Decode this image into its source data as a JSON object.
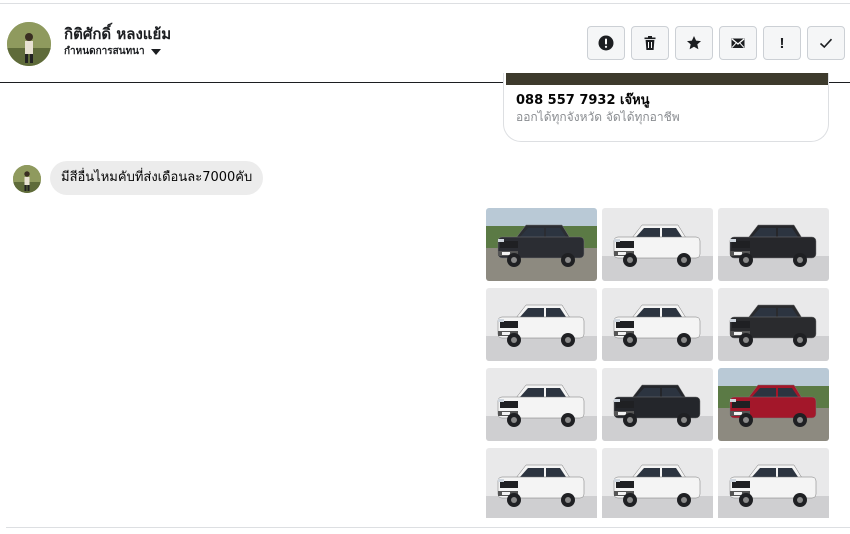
{
  "header": {
    "contact_name": "กิติศักดิ์ หลงแย้ม",
    "subtitle": "กำหนดการสนทนา",
    "actions": [
      {
        "icon": "alert-circle-icon"
      },
      {
        "icon": "trash-icon"
      },
      {
        "icon": "star-icon"
      },
      {
        "icon": "mail-icon"
      },
      {
        "icon": "exclamation-icon",
        "label": "!"
      },
      {
        "icon": "check-icon"
      }
    ]
  },
  "card": {
    "title": "088 557 7932 เจ๊หนู",
    "description": "ออกได้ทุกจังหวัด จัดได้ทุกอาชีพ"
  },
  "message": {
    "text": "มีสีอื่นไหมคับที่ส่งเดือนละ7000คับ"
  },
  "gallery": {
    "photos": [
      {
        "car_color": "#2b2d33",
        "bg": "outdoor"
      },
      {
        "car_color": "#f4f4f4",
        "bg": "studio"
      },
      {
        "car_color": "#26272b",
        "bg": "studio"
      },
      {
        "car_color": "#f4f4f4",
        "bg": "studio"
      },
      {
        "car_color": "#f4f4f4",
        "bg": "studio"
      },
      {
        "car_color": "#2a2b2e",
        "bg": "studio"
      },
      {
        "car_color": "#f4f4f4",
        "bg": "studio"
      },
      {
        "car_color": "#24262b",
        "bg": "studio"
      },
      {
        "car_color": "#a3172a",
        "bg": "outdoor"
      },
      {
        "car_color": "#f4f4f4",
        "bg": "studio"
      },
      {
        "car_color": "#f4f4f4",
        "bg": "studio"
      },
      {
        "car_color": "#f4f4f4",
        "bg": "studio"
      }
    ]
  }
}
